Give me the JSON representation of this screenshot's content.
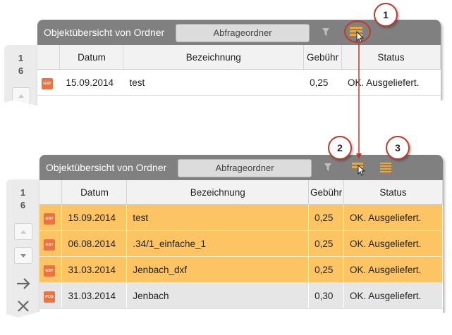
{
  "panel_top": {
    "count_lines": [
      "1",
      "6"
    ],
    "title": "Objektübersicht von Ordner",
    "folder_button": "Abfrageordner",
    "columns": [
      "",
      "Datum",
      "Bezeichnung",
      "Gebühr",
      "Status"
    ],
    "rows": [
      {
        "badge": "GST",
        "date": "15.09.2014",
        "name": "test",
        "fee": "0,25",
        "status": "OK. Ausgeliefert."
      }
    ]
  },
  "panel_bottom": {
    "count_lines": [
      "1",
      "6"
    ],
    "title": "Objektübersicht von Ordner",
    "folder_button": "Abfrageordner",
    "columns": [
      "",
      "Datum",
      "Bezeichnung",
      "Gebühr",
      "Status"
    ],
    "rows": [
      {
        "badge": "GST",
        "date": "15.09.2014",
        "name": "test",
        "fee": "0,25",
        "status": "OK. Ausgeliefert.",
        "selected": true
      },
      {
        "badge": "GST",
        "date": "06.08.2014",
        "name": ".34/1_einfache_1",
        "fee": "0,25",
        "status": "OK. Ausgeliefert.",
        "selected": true
      },
      {
        "badge": "GST",
        "date": "31.03.2014",
        "name": "Jenbach_dxf",
        "fee": "0,25",
        "status": "OK. Ausgeliefert.",
        "selected": true
      },
      {
        "badge": "POS",
        "date": "31.03.2014",
        "name": "Jenbach",
        "fee": "0,30",
        "status": "OK. Ausgeliefert.",
        "selected": false
      }
    ]
  },
  "callouts": [
    "1",
    "2",
    "3"
  ],
  "icons": {
    "filter": "filter-icon",
    "select_all": "select-all-icon",
    "select_all_active": "select-all-cursor-icon",
    "deselect": "deselect-icon",
    "scroll_up": "arrow-up-icon",
    "scroll_down": "arrow-down-icon",
    "go": "arrow-right-icon",
    "close": "close-icon"
  },
  "colors": {
    "titlebar": "#808080",
    "selection": "#fcc462",
    "badge": "#ee7140",
    "callout_border": "#c0392b",
    "arrow": "#c0392b"
  }
}
